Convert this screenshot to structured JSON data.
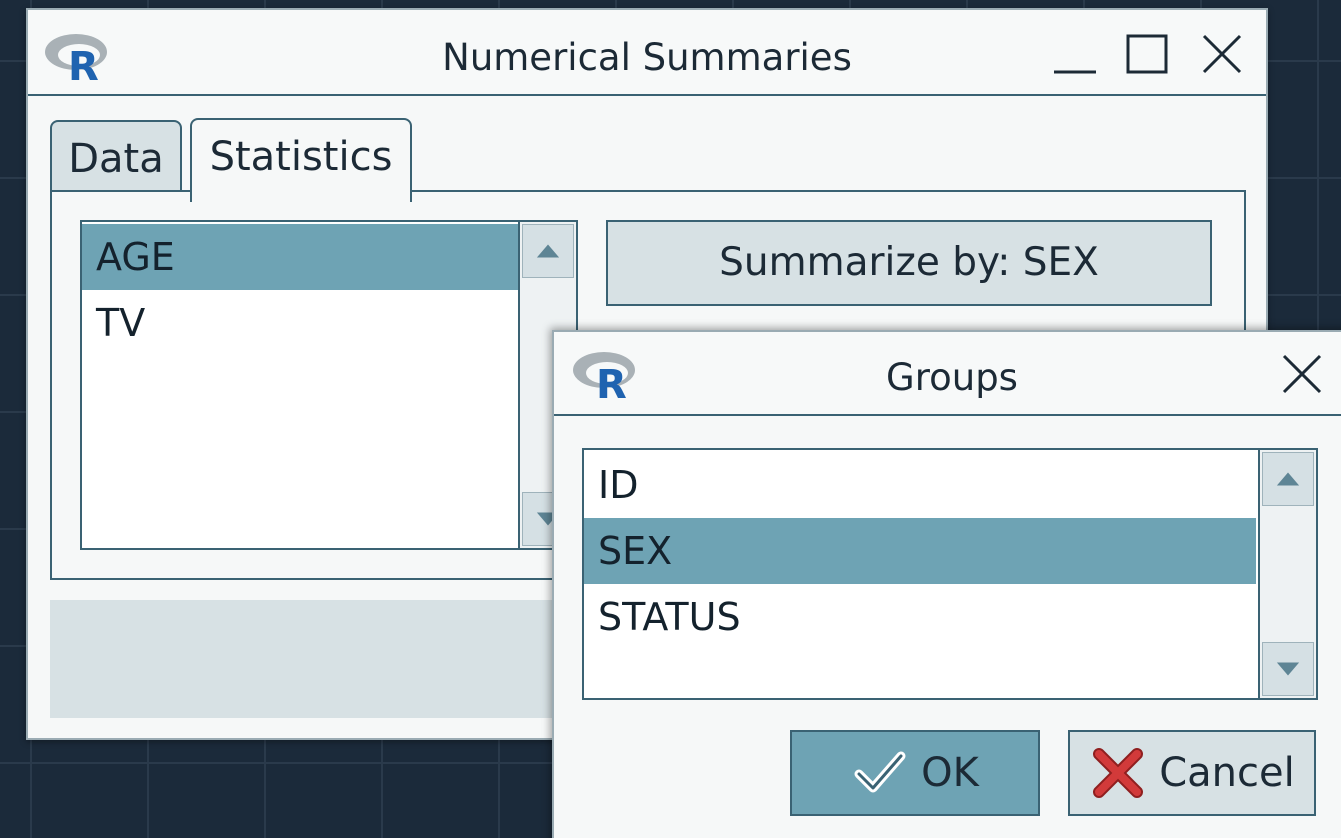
{
  "main_window": {
    "title": "Numerical Summaries",
    "logo_text": "R",
    "tabs": [
      {
        "label": "Data",
        "active": false
      },
      {
        "label": "Statistics",
        "active": true
      }
    ],
    "variables": {
      "items": [
        "AGE",
        "TV"
      ],
      "selected": "AGE"
    },
    "summarize_button_label": "Summarize by: SEX"
  },
  "groups_dialog": {
    "title": "Groups",
    "logo_text": "R",
    "items": [
      "ID",
      "SEX",
      "STATUS"
    ],
    "selected": "SEX",
    "ok_label": "OK",
    "cancel_label": "Cancel"
  },
  "icons": {
    "minimize": "minimize-icon",
    "maximize": "maximize-icon",
    "close": "close-icon",
    "scroll_up": "triangle-up-icon",
    "scroll_down": "triangle-down-icon",
    "ok": "checkmark-icon",
    "cancel": "red-x-icon"
  },
  "colors": {
    "selection": "#6ea3b4",
    "border": "#3a6273",
    "r_logo_blue": "#1f63b0",
    "cancel_red": "#d23a3a"
  }
}
